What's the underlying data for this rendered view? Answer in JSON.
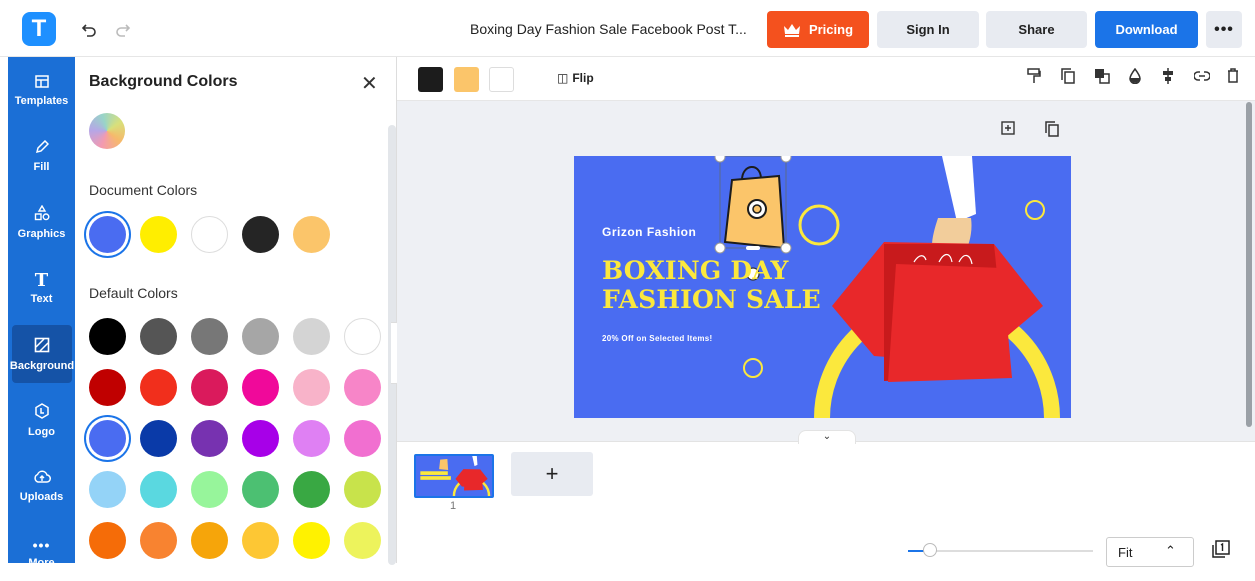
{
  "header": {
    "logo_letter": "T",
    "undo_icon": "undo-icon",
    "redo_icon": "redo-icon",
    "doc_title": "Boxing Day Fashion Sale Facebook Post T...",
    "pricing_label": "Pricing",
    "signin_label": "Sign In",
    "share_label": "Share",
    "download_label": "Download",
    "more_label": "•••"
  },
  "sidebar": {
    "items": [
      {
        "label": "Templates",
        "icon": "templates-icon"
      },
      {
        "label": "Fill",
        "icon": "pencil-icon"
      },
      {
        "label": "Graphics",
        "icon": "shapes-icon"
      },
      {
        "label": "Text",
        "icon": "text-icon"
      },
      {
        "label": "Background",
        "icon": "background-icon",
        "active": true
      },
      {
        "label": "Logo",
        "icon": "logo-icon"
      },
      {
        "label": "Uploads",
        "icon": "upload-icon"
      },
      {
        "label": "More",
        "icon": "more-icon"
      }
    ]
  },
  "panel": {
    "title": "Background Colors",
    "document_colors_label": "Document Colors",
    "default_colors_label": "Default Colors",
    "document_colors": [
      "#4a6cf1",
      "#ffee00",
      "#ffffff",
      "#252525",
      "#fbc56a"
    ],
    "default_colors": [
      [
        "#000000",
        "#555555",
        "#777777",
        "#a6a6a6",
        "#d4d4d4",
        "#ffffff"
      ],
      [
        "#c00000",
        "#f12f1c",
        "#da1a5c",
        "#f0099a",
        "#f8b3c9",
        "#f785c8"
      ],
      [
        "#4a6cf1",
        "#0a3aa8",
        "#7732b0",
        "#a700e8",
        "#df80f3",
        "#f16fd0"
      ],
      [
        "#94d3f7",
        "#5ad8e0",
        "#97f59b",
        "#4cc072",
        "#39a843",
        "#c8e34b"
      ],
      [
        "#f56c08",
        "#f88330",
        "#f6a50a",
        "#fdc734",
        "#fff200",
        "#edf35c"
      ]
    ]
  },
  "toolbar": {
    "swatches": [
      "#1c1c1c",
      "#fbc56a",
      "#ffffff"
    ],
    "flip_label": "Flip",
    "icons": [
      "paint-roller-icon",
      "copy-icon",
      "layer-icon",
      "opacity-icon",
      "align-icon",
      "link-icon",
      "trash-icon"
    ]
  },
  "canvas": {
    "brand": "Grizon Fashion",
    "headline_line1": "BOXING DAY",
    "headline_line2": "FASHION SALE",
    "subline": "20% Off on Selected Items!",
    "background_color": "#4a6cf1",
    "headline_color": "#fbe83d"
  },
  "filmstrip": {
    "page_number": "1",
    "add_page_label": "+"
  },
  "footer": {
    "zoom_level": 0.12,
    "fit_label": "Fit",
    "pages_icon": "pages-icon"
  }
}
